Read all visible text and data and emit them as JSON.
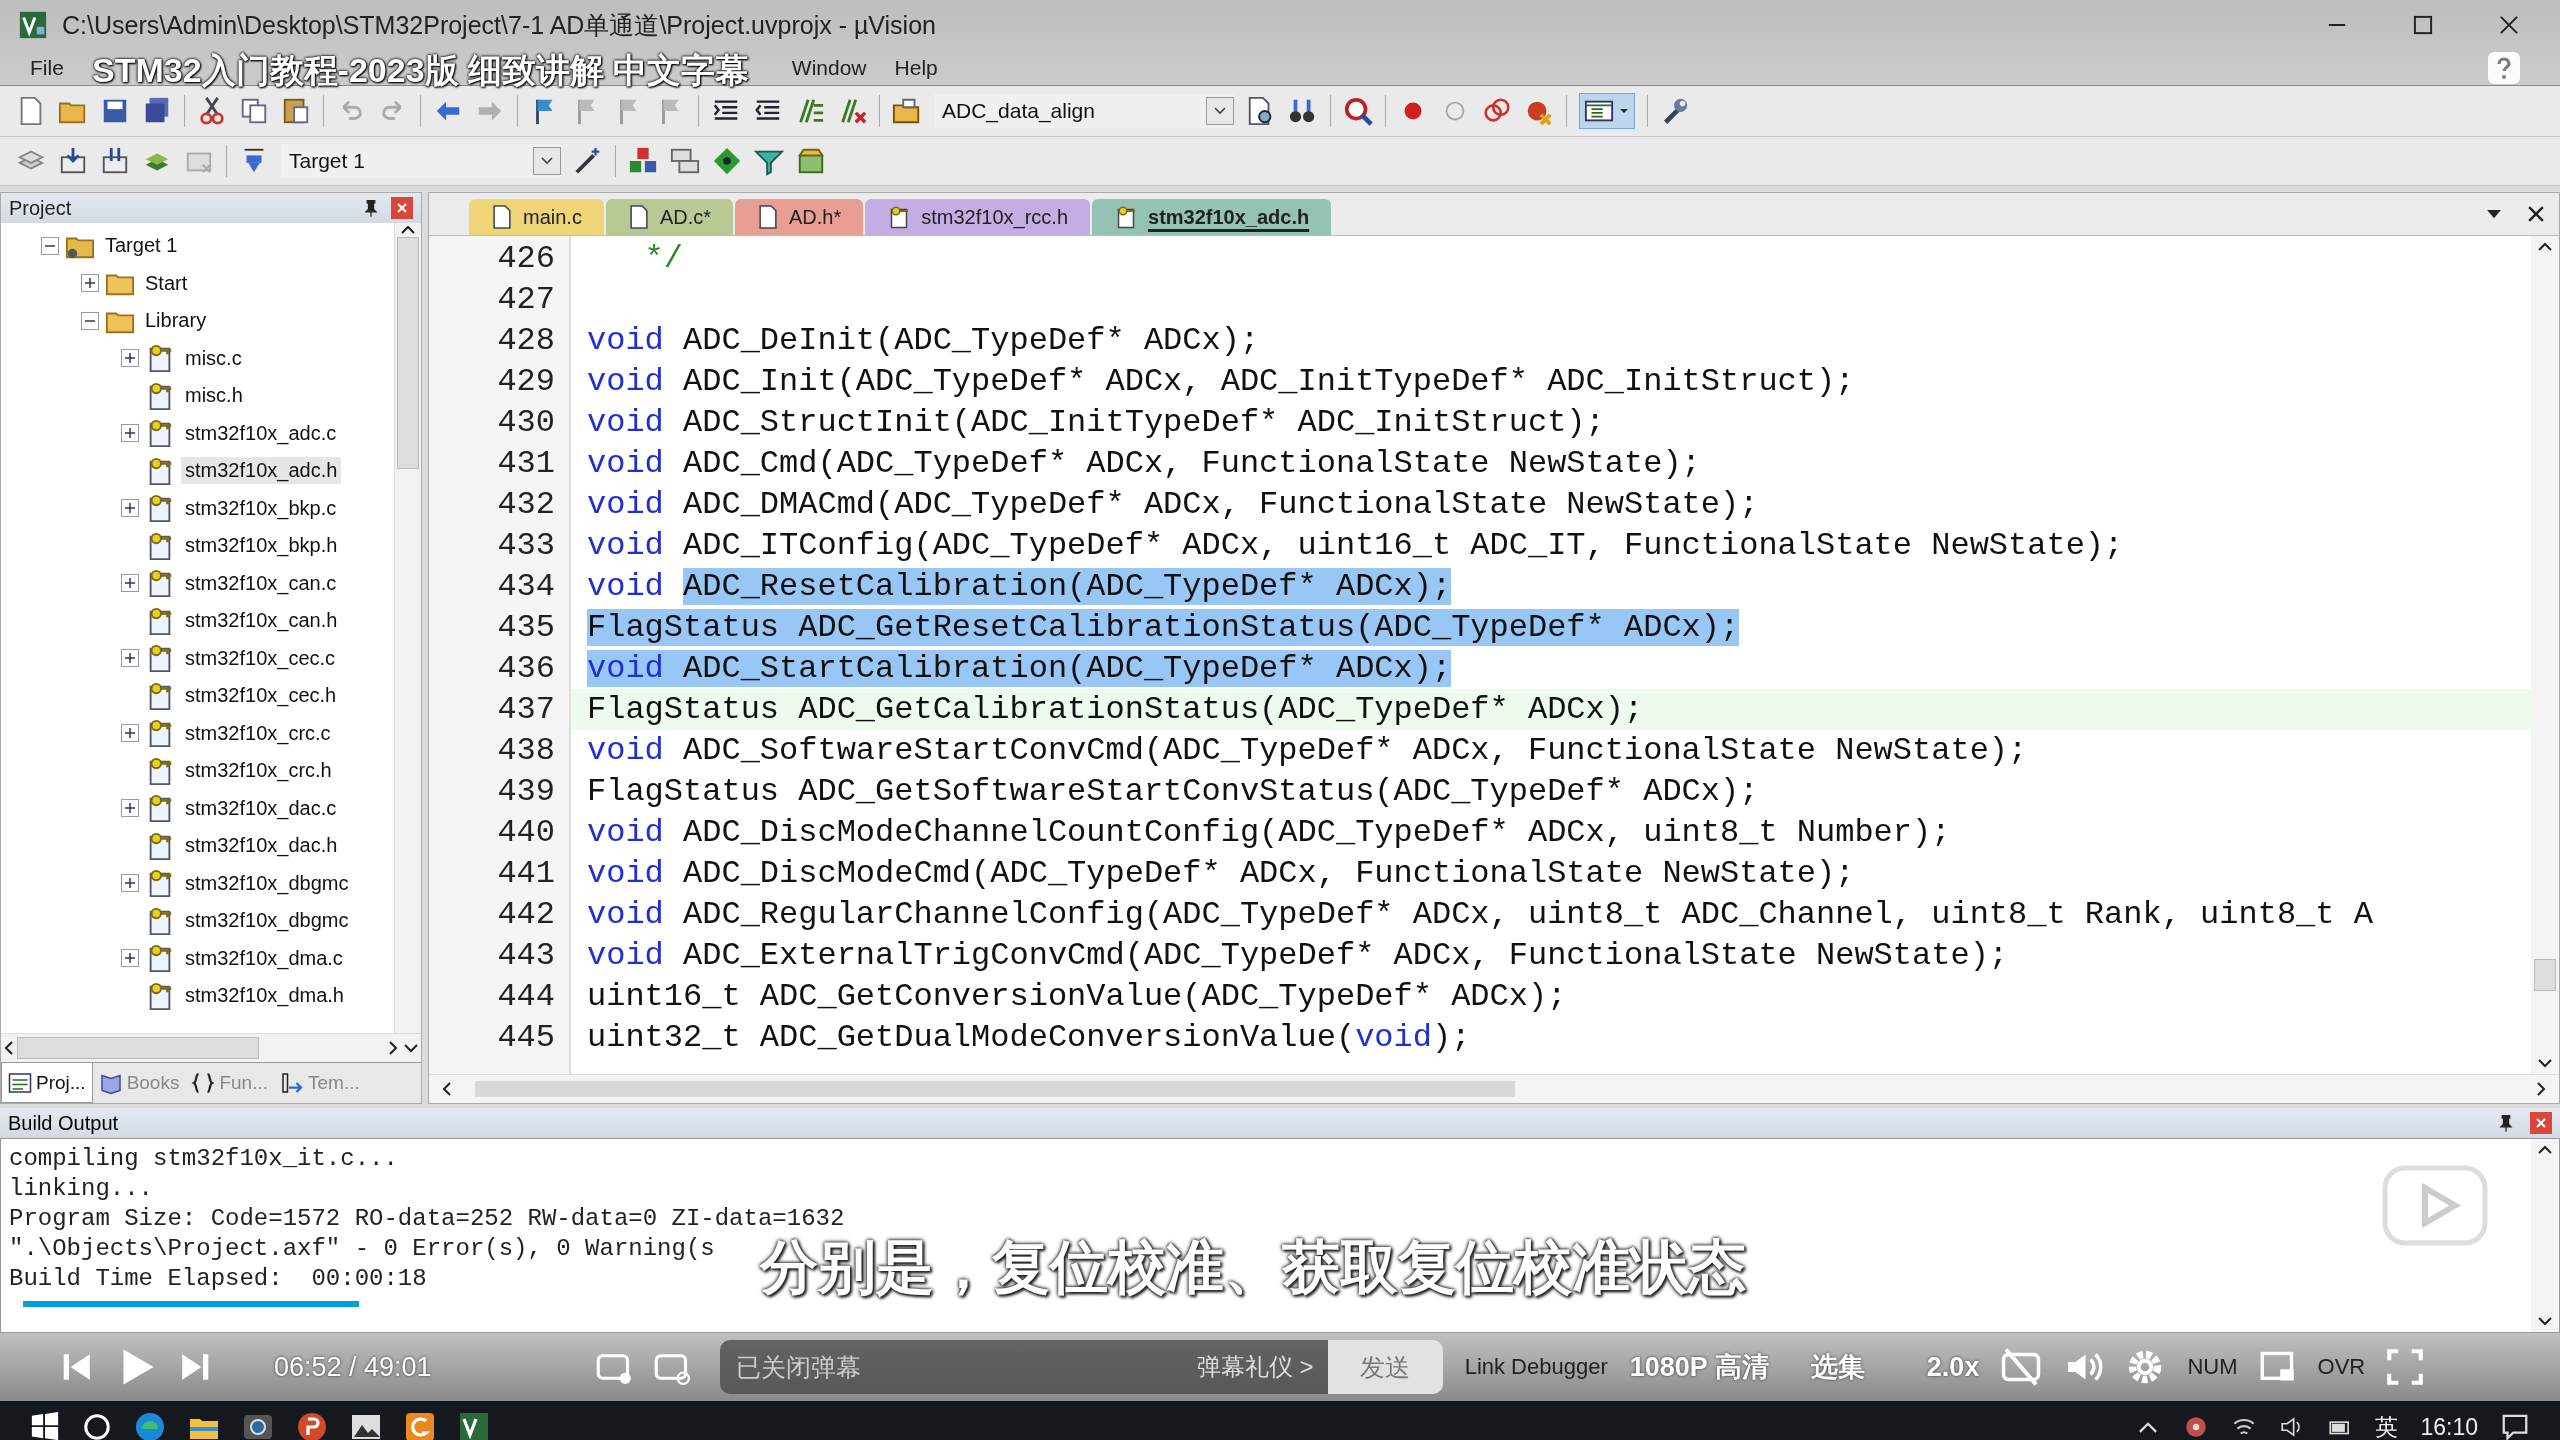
{
  "window": {
    "title": "C:\\Users\\Admin\\Desktop\\STM32Project\\7-1 AD单通道\\Project.uvprojx - µVision"
  },
  "menu": [
    "File",
    "Window",
    "Help"
  ],
  "video_overlay": {
    "title": "STM32入门教程-2023版 细致讲解 中文字幕",
    "subtitle": "分别是，复位校准、获取复位校准状态"
  },
  "toolbar": {
    "find_combo": "ADC_data_align",
    "target_combo": "Target 1"
  },
  "project_panel": {
    "title": "Project",
    "tree": [
      {
        "label": "Target 1",
        "kind": "target",
        "expanded": true,
        "selected": false,
        "children": [
          {
            "label": "Start",
            "kind": "folder",
            "expanded": false,
            "selected": false
          },
          {
            "label": "Library",
            "kind": "folder",
            "expanded": true,
            "selected": false,
            "children": [
              {
                "label": "misc.c",
                "kind": "file",
                "expanded": false,
                "selected": false
              },
              {
                "label": "misc.h",
                "kind": "file",
                "selected": false
              },
              {
                "label": "stm32f10x_adc.c",
                "kind": "file",
                "expanded": false,
                "selected": false
              },
              {
                "label": "stm32f10x_adc.h",
                "kind": "file",
                "selected": true
              },
              {
                "label": "stm32f10x_bkp.c",
                "kind": "file",
                "expanded": false,
                "selected": false
              },
              {
                "label": "stm32f10x_bkp.h",
                "kind": "file",
                "selected": false
              },
              {
                "label": "stm32f10x_can.c",
                "kind": "file",
                "expanded": false,
                "selected": false
              },
              {
                "label": "stm32f10x_can.h",
                "kind": "file",
                "selected": false
              },
              {
                "label": "stm32f10x_cec.c",
                "kind": "file",
                "expanded": false,
                "selected": false
              },
              {
                "label": "stm32f10x_cec.h",
                "kind": "file",
                "selected": false
              },
              {
                "label": "stm32f10x_crc.c",
                "kind": "file",
                "expanded": false,
                "selected": false
              },
              {
                "label": "stm32f10x_crc.h",
                "kind": "file",
                "selected": false
              },
              {
                "label": "stm32f10x_dac.c",
                "kind": "file",
                "expanded": false,
                "selected": false
              },
              {
                "label": "stm32f10x_dac.h",
                "kind": "file",
                "selected": false
              },
              {
                "label": "stm32f10x_dbgmc",
                "kind": "file",
                "expanded": false,
                "selected": false
              },
              {
                "label": "stm32f10x_dbgmc",
                "kind": "file",
                "selected": false
              },
              {
                "label": "stm32f10x_dma.c",
                "kind": "file",
                "expanded": false,
                "selected": false
              },
              {
                "label": "stm32f10x_dma.h",
                "kind": "file",
                "selected": false
              }
            ]
          }
        ]
      }
    ],
    "tabs": [
      {
        "label": "Proj...",
        "kind": "project",
        "selected": true
      },
      {
        "label": "Books",
        "kind": "books",
        "selected": false
      },
      {
        "label": "Fun...",
        "kind": "functions",
        "selected": false
      },
      {
        "label": "Tem...",
        "kind": "templates",
        "selected": false
      }
    ]
  },
  "editor_tabs": [
    {
      "label": "main.c",
      "kind": "source",
      "color": "#f0d478",
      "selected": false
    },
    {
      "label": "AD.c*",
      "kind": "source",
      "color": "#b9c995",
      "selected": false
    },
    {
      "label": "AD.h*",
      "kind": "source",
      "color": "#e99e94",
      "selected": false
    },
    {
      "label": "stm32f10x_rcc.h",
      "kind": "library",
      "color": "#c4ade2",
      "selected": false
    },
    {
      "label": "stm32f10x_adc.h",
      "kind": "library",
      "color": "#94c2b4",
      "selected": true
    }
  ],
  "code_lines": [
    {
      "number": "426",
      "current": false,
      "parts": [
        {
          "kind": "comment",
          "text": "   */",
          "selected": false
        }
      ]
    },
    {
      "number": "427",
      "current": false
    },
    {
      "number": "428",
      "current": false,
      "parts": [
        {
          "kind": "keyword",
          "text": "void",
          "selected": false
        },
        {
          "kind": "plain",
          "text": " ADC_DeInit(ADC_TypeDef* ADCx);",
          "selected": false
        }
      ]
    },
    {
      "number": "429",
      "current": false,
      "parts": [
        {
          "kind": "keyword",
          "text": "void",
          "selected": false
        },
        {
          "kind": "plain",
          "text": " ADC_Init(ADC_TypeDef* ADCx, ADC_InitTypeDef* ADC_InitStruct);",
          "selected": false
        }
      ]
    },
    {
      "number": "430",
      "current": false,
      "parts": [
        {
          "kind": "keyword",
          "text": "void",
          "selected": false
        },
        {
          "kind": "plain",
          "text": " ADC_StructInit(ADC_InitTypeDef* ADC_InitStruct);",
          "selected": false
        }
      ]
    },
    {
      "number": "431",
      "current": false,
      "parts": [
        {
          "kind": "keyword",
          "text": "void",
          "selected": false
        },
        {
          "kind": "plain",
          "text": " ADC_Cmd(ADC_TypeDef* ADCx, FunctionalState NewState);",
          "selected": false
        }
      ]
    },
    {
      "number": "432",
      "current": false,
      "parts": [
        {
          "kind": "keyword",
          "text": "void",
          "selected": false
        },
        {
          "kind": "plain",
          "text": " ADC_DMACmd(ADC_TypeDef* ADCx, FunctionalState NewState);",
          "selected": false
        }
      ]
    },
    {
      "number": "433",
      "current": false,
      "parts": [
        {
          "kind": "keyword",
          "text": "void",
          "selected": false
        },
        {
          "kind": "plain",
          "text": " ADC_ITConfig(ADC_TypeDef* ADCx, uint16_t ADC_IT, FunctionalState NewState);",
          "selected": false
        }
      ]
    },
    {
      "number": "434",
      "current": false,
      "parts": [
        {
          "kind": "keyword",
          "text": "void ",
          "selected": false
        },
        {
          "kind": "plain",
          "text": "ADC_ResetCalibration(ADC_TypeDef* ADCx);",
          "selected": true
        }
      ]
    },
    {
      "number": "435",
      "current": false,
      "parts": [
        {
          "kind": "plain",
          "text": "FlagStatus ADC_GetResetCalibrationStatus(ADC_TypeDef* ADCx);",
          "selected": true
        }
      ]
    },
    {
      "number": "436",
      "current": false,
      "parts": [
        {
          "kind": "keyword",
          "text": "void",
          "selected": true
        },
        {
          "kind": "plain",
          "text": " ADC_StartCalibration(ADC_TypeDef* ADCx);",
          "selected": true
        }
      ]
    },
    {
      "number": "437",
      "current": true,
      "parts": [
        {
          "kind": "plain",
          "text": "FlagStatus ADC_GetCalibrationStatus(ADC_TypeDef* ADCx);",
          "selected": false
        }
      ]
    },
    {
      "number": "438",
      "current": false,
      "parts": [
        {
          "kind": "keyword",
          "text": "void",
          "selected": false
        },
        {
          "kind": "plain",
          "text": " ADC_SoftwareStartConvCmd(ADC_TypeDef* ADCx, FunctionalState NewState);",
          "selected": false
        }
      ]
    },
    {
      "number": "439",
      "current": false,
      "parts": [
        {
          "kind": "plain",
          "text": "FlagStatus ADC_GetSoftwareStartConvStatus(ADC_TypeDef* ADCx);",
          "selected": false
        }
      ]
    },
    {
      "number": "440",
      "current": false,
      "parts": [
        {
          "kind": "keyword",
          "text": "void",
          "selected": false
        },
        {
          "kind": "plain",
          "text": " ADC_DiscModeChannelCountConfig(ADC_TypeDef* ADCx, uint8_t Number);",
          "selected": false
        }
      ]
    },
    {
      "number": "441",
      "current": false,
      "parts": [
        {
          "kind": "keyword",
          "text": "void",
          "selected": false
        },
        {
          "kind": "plain",
          "text": " ADC_DiscModeCmd(ADC_TypeDef* ADCx, FunctionalState NewState);",
          "selected": false
        }
      ]
    },
    {
      "number": "442",
      "current": false,
      "parts": [
        {
          "kind": "keyword",
          "text": "void",
          "selected": false
        },
        {
          "kind": "plain",
          "text": " ADC_RegularChannelConfig(ADC_TypeDef* ADCx, uint8_t ADC_Channel, uint8_t Rank, uint8_t A",
          "selected": false
        }
      ]
    },
    {
      "number": "443",
      "current": false,
      "parts": [
        {
          "kind": "keyword",
          "text": "void",
          "selected": false
        },
        {
          "kind": "plain",
          "text": " ADC_ExternalTrigConvCmd(ADC_TypeDef* ADCx, FunctionalState NewState);",
          "selected": false
        }
      ]
    },
    {
      "number": "444",
      "current": false,
      "parts": [
        {
          "kind": "plain",
          "text": "uint16_t ADC_GetConversionValue(ADC_TypeDef* ADCx);",
          "selected": false
        }
      ]
    },
    {
      "number": "445",
      "current": false,
      "parts": [
        {
          "kind": "plain",
          "text": "uint32_t ADC_GetDualModeConversionValue(",
          "selected": false
        },
        {
          "kind": "keyword",
          "text": "void",
          "selected": false
        },
        {
          "kind": "plain",
          "text": ");",
          "selected": false
        }
      ]
    }
  ],
  "build_output": {
    "title": "Build Output",
    "lines": [
      "compiling stm32f10x_it.c...",
      "linking...",
      "Program Size: Code=1572 RO-data=252 RW-data=0 ZI-data=1632",
      "\".\\Objects\\Project.axf\" - 0 Error(s), 0 Warning(s",
      "Build Time Elapsed:  00:00:18"
    ]
  },
  "player_bar": {
    "progress": {
      "level": 0.14
    },
    "time": "06:52 / 49:01",
    "danmaku_input": {
      "placeholder": "已关闭弹幕"
    },
    "etiquette_link": "弹幕礼仪 >",
    "send_button": "发送",
    "quality": "1080P 高清",
    "episodes": "选集",
    "speed": "2.0x"
  },
  "status_bar": [
    "Link Debugger",
    "NUM",
    "OVR"
  ],
  "taskbar": {
    "input_method": "英",
    "clock": "16:10"
  }
}
